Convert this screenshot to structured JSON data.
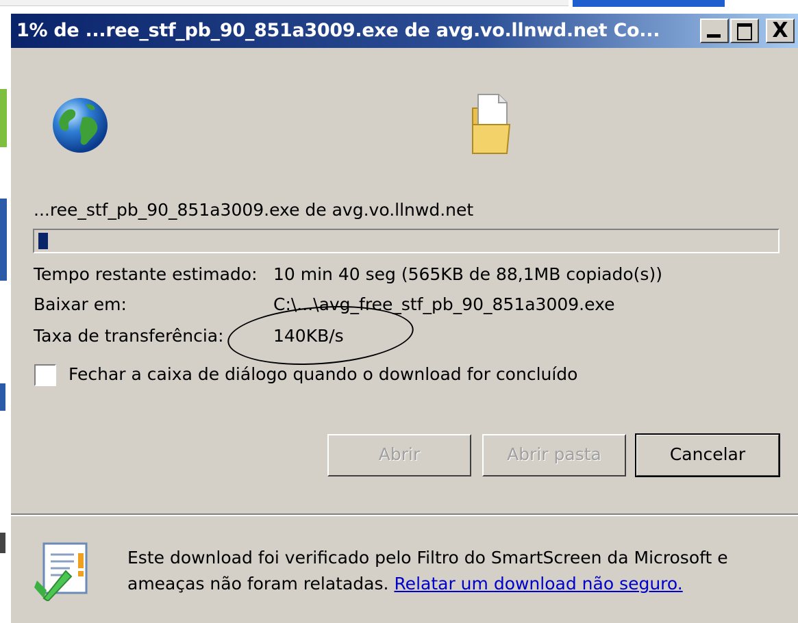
{
  "window": {
    "title": "1% de ...ree_stf_pb_90_851a3009.exe de avg.vo.llnwd.net Co...",
    "controls": {
      "minimize": "_",
      "maximize": "□",
      "close": "X"
    }
  },
  "download": {
    "source": "...ree_stf_pb_90_851a3009.exe de avg.vo.llnwd.net",
    "progress_percent": 1,
    "rows": {
      "tempo_label": "Tempo restante estimado:",
      "tempo_value": "10 min 40 seg (565KB de 88,1MB copiado(s))",
      "baixar_label": "Baixar em:",
      "baixar_value": "C:\\...\\avg_free_stf_pb_90_851a3009.exe",
      "taxa_label": "Taxa de transferência:",
      "taxa_value": "140KB/s"
    },
    "close_when_done": {
      "label": "Fechar a caixa de diálogo quando o download for concluído",
      "checked": false
    }
  },
  "buttons": {
    "open": "Abrir",
    "open_folder": "Abrir pasta",
    "cancel": "Cancelar"
  },
  "smartscreen": {
    "line1": "Este download foi verificado pelo Filtro do SmartScreen da Microsoft e",
    "line2_text": "ameaças não foram relatadas.",
    "link": "Relatar um download não seguro."
  },
  "icons": {
    "globe": "globe-icon",
    "file": "file-folder-icon",
    "shield": "smartscreen-check-icon"
  }
}
